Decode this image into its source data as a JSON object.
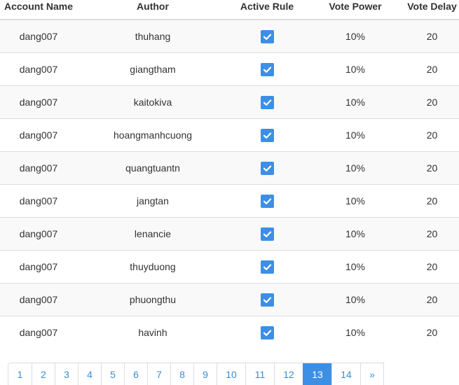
{
  "table": {
    "headers": {
      "account": "Account Name",
      "author": "Author",
      "active": "Active Rule",
      "power": "Vote Power",
      "delay": "Vote Delay"
    },
    "rows": [
      {
        "account": "dang007",
        "author": "thuhang",
        "active": true,
        "power": "10%",
        "delay": "20"
      },
      {
        "account": "dang007",
        "author": "giangtham",
        "active": true,
        "power": "10%",
        "delay": "20"
      },
      {
        "account": "dang007",
        "author": "kaitokiva",
        "active": true,
        "power": "10%",
        "delay": "20"
      },
      {
        "account": "dang007",
        "author": "hoangmanhcuong",
        "active": true,
        "power": "10%",
        "delay": "20"
      },
      {
        "account": "dang007",
        "author": "quangtuantn",
        "active": true,
        "power": "10%",
        "delay": "20"
      },
      {
        "account": "dang007",
        "author": "jangtan",
        "active": true,
        "power": "10%",
        "delay": "20"
      },
      {
        "account": "dang007",
        "author": "lenancie",
        "active": true,
        "power": "10%",
        "delay": "20"
      },
      {
        "account": "dang007",
        "author": "thuyduong",
        "active": true,
        "power": "10%",
        "delay": "20"
      },
      {
        "account": "dang007",
        "author": "phuongthu",
        "active": true,
        "power": "10%",
        "delay": "20"
      },
      {
        "account": "dang007",
        "author": "havinh",
        "active": true,
        "power": "10%",
        "delay": "20"
      }
    ]
  },
  "pagination": {
    "pages": [
      "1",
      "2",
      "3",
      "4",
      "5",
      "6",
      "7",
      "8",
      "9",
      "10",
      "11",
      "12",
      "13",
      "14"
    ],
    "current": "13",
    "next_label": "»"
  },
  "colors": {
    "accent": "#3d8fe6",
    "link": "#3b8bd9"
  },
  "icons": {
    "checkbox": "checkbox-checked-icon"
  }
}
